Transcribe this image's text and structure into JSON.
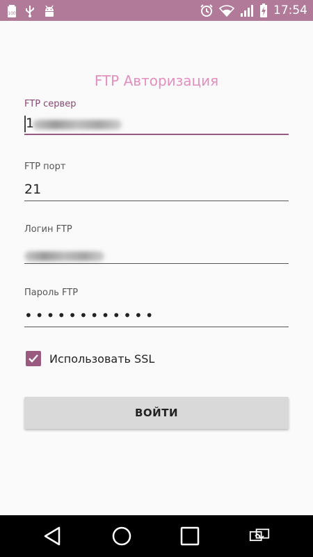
{
  "status_bar": {
    "time": "17:54",
    "battery_level_text": "100",
    "icons": [
      "battery-100-notification-icon",
      "usb-icon",
      "android-debug-icon",
      "alarm-icon",
      "wifi-icon",
      "signal-icon",
      "battery-charging-icon"
    ]
  },
  "form": {
    "title": "FTP Авторизация",
    "server": {
      "label": "FTP сервер",
      "value": "1"
    },
    "port": {
      "label": "FTP порт",
      "value": "21"
    },
    "login": {
      "label": "Логин FTP",
      "value": ""
    },
    "password": {
      "label": "Пароль  FTP",
      "value": "••••••••••••"
    },
    "ssl": {
      "label": "Использовать SSL",
      "checked": true
    },
    "submit_label": "ВОЙТИ"
  },
  "colors": {
    "accent": "#9a5a80",
    "status_bar": "#b07a98",
    "title": "#e38fbf",
    "button": "#d8d9d8"
  },
  "nav_bar": {
    "icons": [
      "back-icon",
      "home-icon",
      "recents-icon",
      "screen-rotate-icon"
    ]
  }
}
